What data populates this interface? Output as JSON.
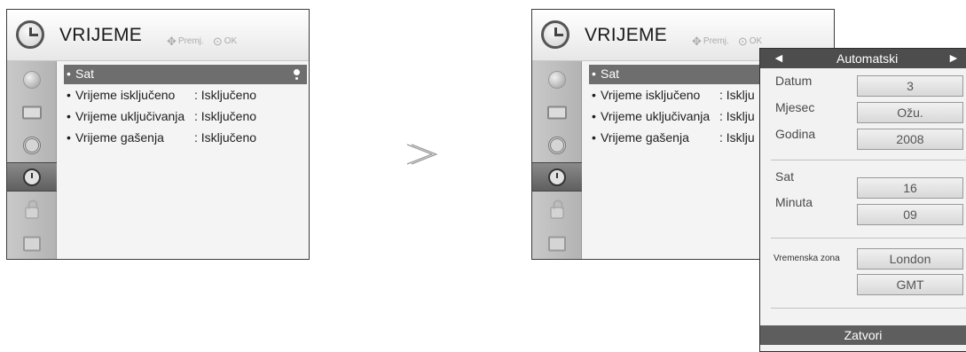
{
  "menu": {
    "title": "VRIJEME",
    "nav_hint_move": "Premj.",
    "nav_hint_ok": "OK",
    "items": [
      {
        "label": "Sat",
        "value": ""
      },
      {
        "label": "Vrijeme isključeno",
        "value": ": Isključeno"
      },
      {
        "label": "Vrijeme uključivanja",
        "value": ": Isključeno"
      },
      {
        "label": "Vrijeme gašenja",
        "value": ": Isključeno"
      }
    ],
    "truncated_values": [
      ": Isklju",
      ": Isklju",
      ": Isklju"
    ],
    "sidebar_icons": [
      "picture-icon",
      "screen-icon",
      "audio-icon",
      "clock-icon",
      "lock-icon",
      "option-icon"
    ],
    "active_sidebar_index": 3
  },
  "clock_popup": {
    "mode": "Automatski",
    "left_arrow": "◄",
    "right_arrow": "►",
    "fields": {
      "datum": {
        "label": "Datum",
        "value": "3"
      },
      "mjesec": {
        "label": "Mjesec",
        "value": "Ožu."
      },
      "godina": {
        "label": "Godina",
        "value": "2008"
      },
      "sat": {
        "label": "Sat",
        "value": "16"
      },
      "minuta": {
        "label": "Minuta",
        "value": "09"
      },
      "zona": {
        "label": "Vremenska zona",
        "value": "London"
      },
      "gmt": {
        "value": "GMT"
      }
    },
    "close_label": "Zatvori"
  },
  "colors": {
    "selected_bar": "#6e6e6e",
    "popup_header": "#4d4d4d",
    "sidebar": "#bdbdbd"
  }
}
